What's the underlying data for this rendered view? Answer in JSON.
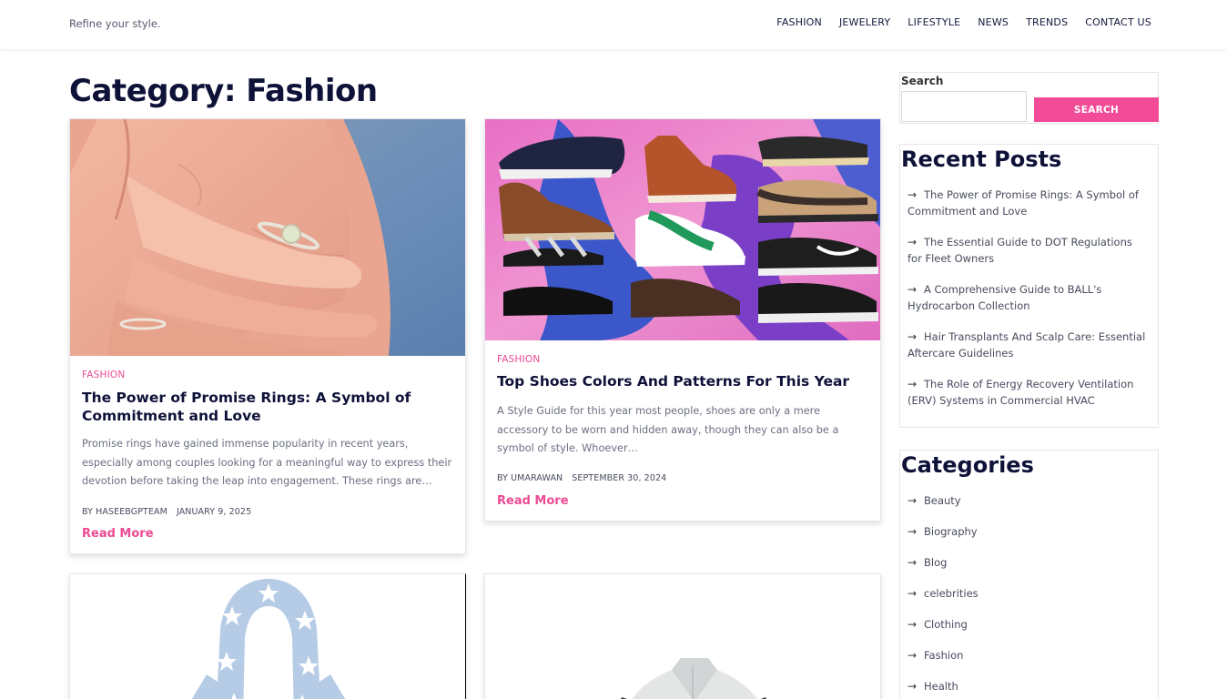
{
  "header": {
    "tagline": "Refine your style.",
    "nav": [
      "FASHION",
      "JEWELERY",
      "LIFESTYLE",
      "NEWS",
      "TRENDS",
      "CONTACT US"
    ]
  },
  "page_title": "Category: Fashion",
  "posts": [
    {
      "category": "FASHION",
      "title": "The Power of Promise Rings: A Symbol of Commitment and Love",
      "excerpt": "Promise rings have gained immense popularity in recent years, especially among couples looking for a meaningful way to express their devotion before taking the leap into engagement. These rings are…",
      "author": "BY HASEEBGPTEAM",
      "date": "JANUARY 9, 2025",
      "read_more": "Read More"
    },
    {
      "category": "FASHION",
      "title": "Top Shoes Colors And Patterns For This Year",
      "excerpt": "A Style Guide for this year most people, shoes are only a mere accessory to be worn and hidden away, though they can also be a symbol of style.  Whoever…",
      "author": "BY UMARAWAN",
      "date": "SEPTEMBER 30, 2024",
      "read_more": "Read More"
    }
  ],
  "sidebar": {
    "search_label": "Search",
    "search_button": "SEARCH",
    "recent_title": "Recent Posts",
    "recent_posts": [
      "The Power of Promise Rings: A Symbol of Commitment and Love",
      "The Essential Guide to DOT Regulations for Fleet Owners",
      "A Comprehensive Guide to BALL's Hydrocarbon Collection",
      "Hair Transplants And Scalp Care: Essential Aftercare Guidelines",
      "The Role of Energy Recovery Ventilation (ERV) Systems in Commercial HVAC"
    ],
    "categories_title": "Categories",
    "categories": [
      "Beauty",
      "Biography",
      "Blog",
      "celebrities",
      "Clothing",
      "Fashion",
      "Health"
    ]
  },
  "colors": {
    "accent": "#ec4a94",
    "button": "#f24b97",
    "heading": "#0f1238"
  }
}
